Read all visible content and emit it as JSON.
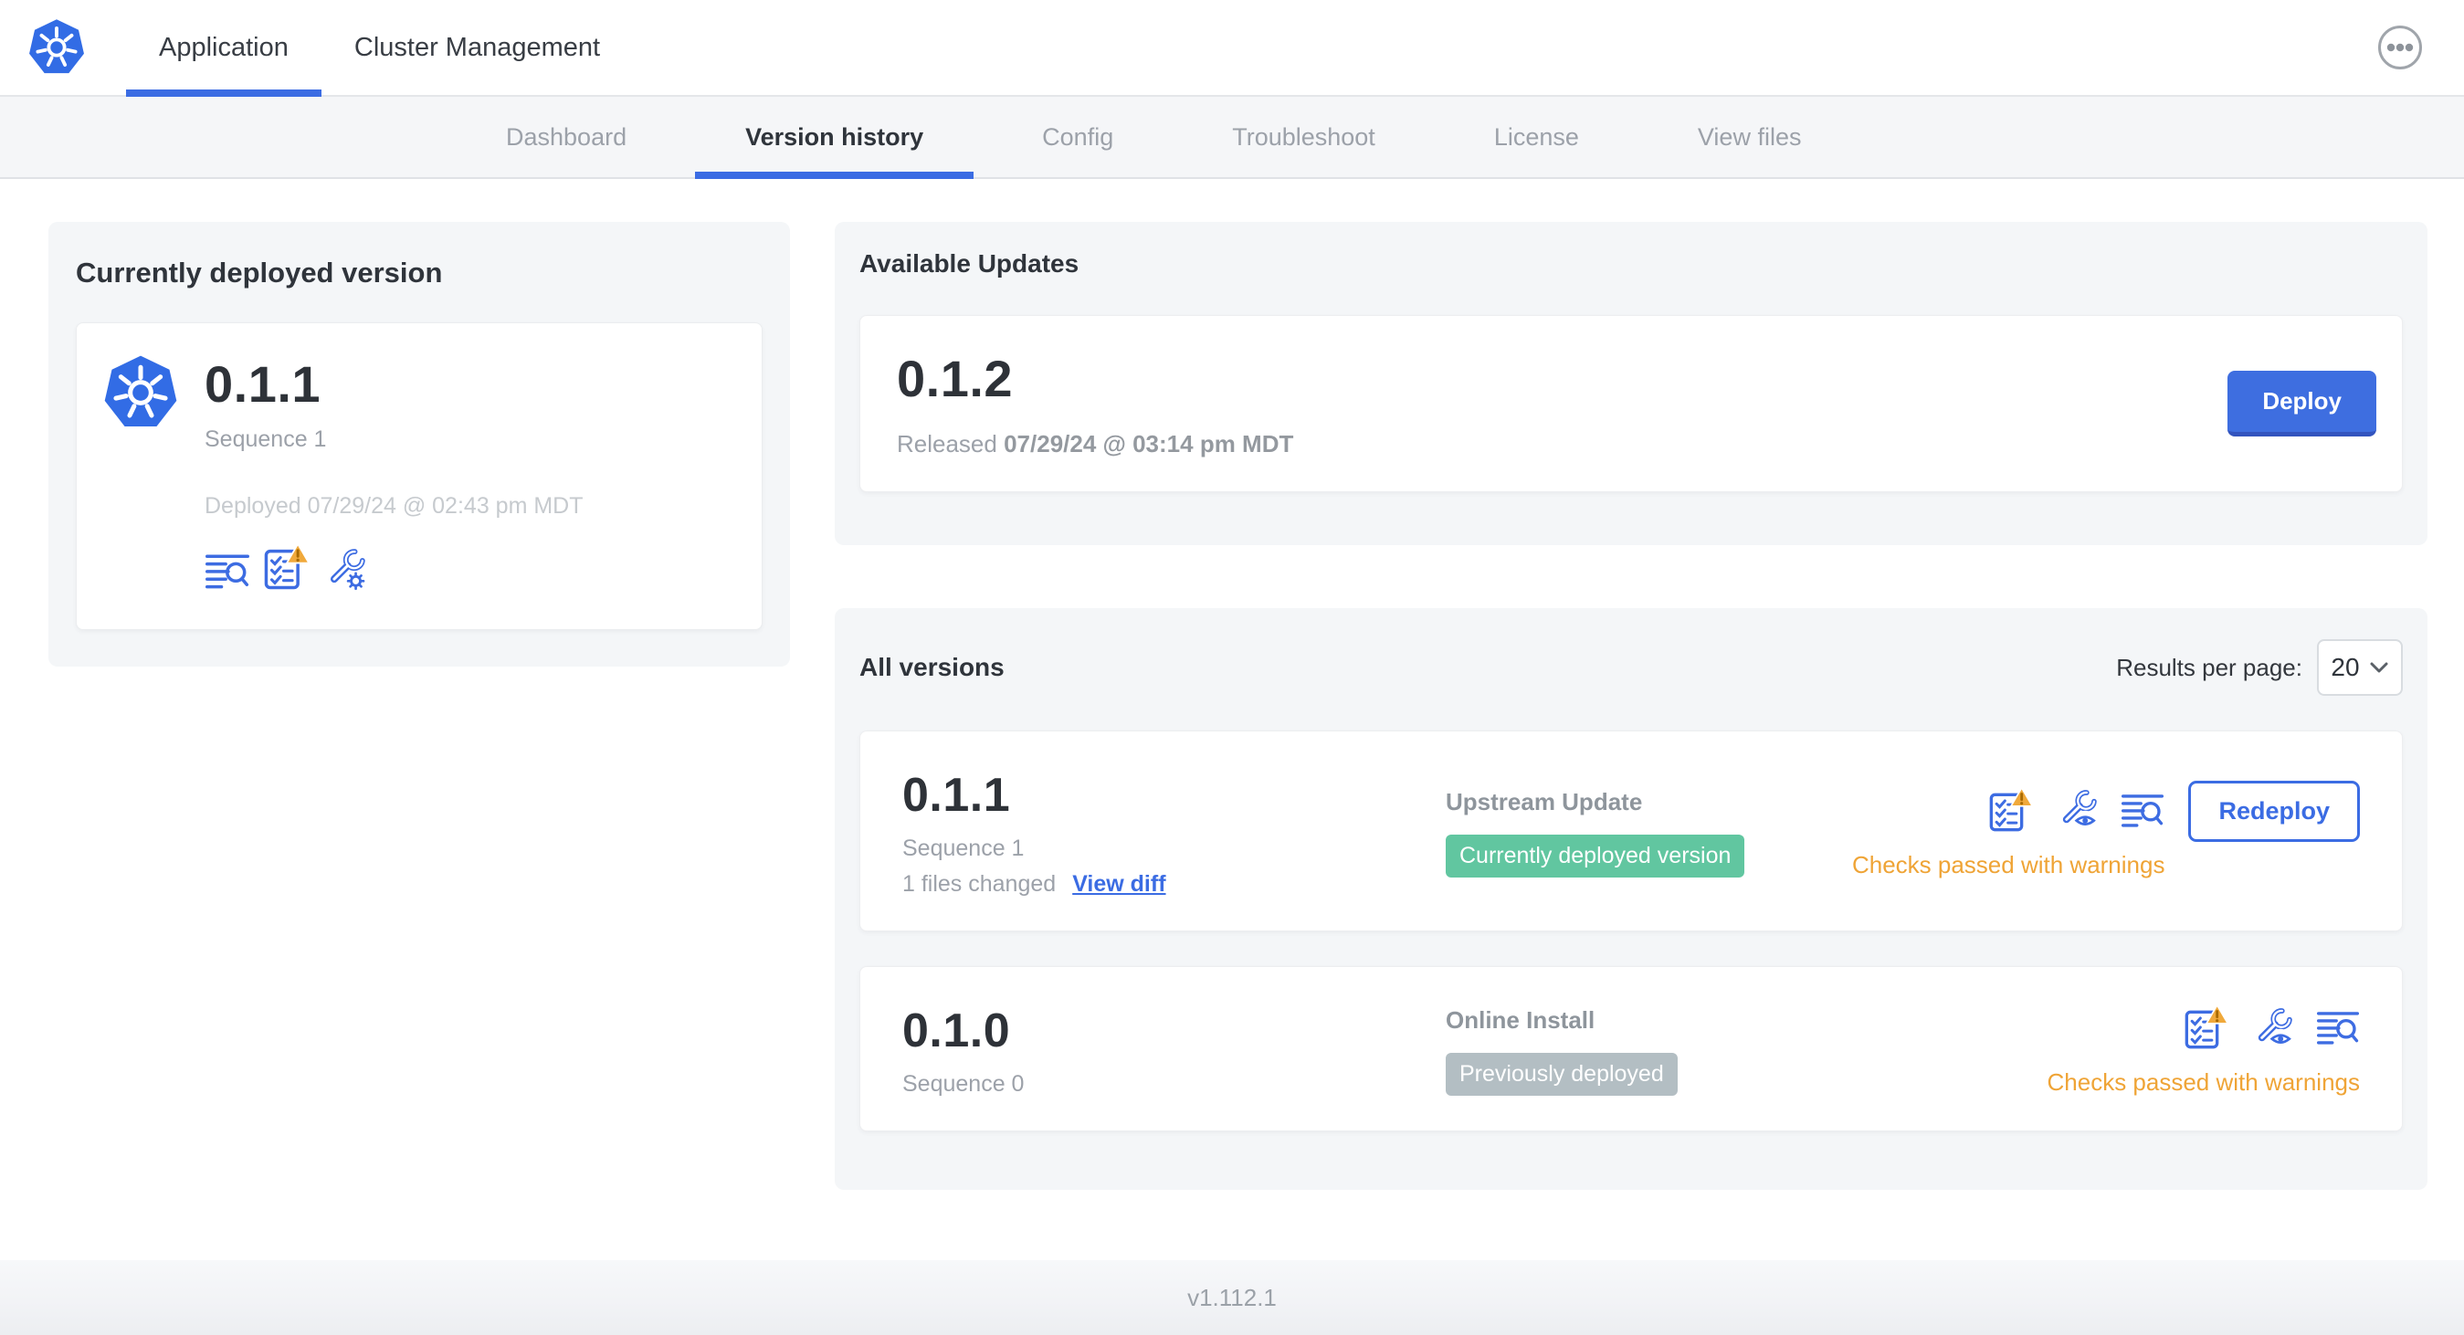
{
  "topbar": {
    "tabs": [
      {
        "label": "Application"
      },
      {
        "label": "Cluster Management"
      }
    ]
  },
  "subnav": {
    "tabs": [
      {
        "label": "Dashboard"
      },
      {
        "label": "Version history"
      },
      {
        "label": "Config"
      },
      {
        "label": "Troubleshoot"
      },
      {
        "label": "License"
      },
      {
        "label": "View files"
      }
    ],
    "active_tab": "Version history"
  },
  "current": {
    "title": "Currently deployed version",
    "version": "0.1.1",
    "sequence": "Sequence 1",
    "deployed": "Deployed 07/29/24 @ 02:43 pm MDT"
  },
  "updates": {
    "title": "Available Updates",
    "version": "0.1.2",
    "released_label": "Released",
    "released_date": "07/29/24 @ 03:14 pm MDT",
    "deploy_label": "Deploy"
  },
  "all_versions": {
    "title": "All versions",
    "results_label": "Results per page:",
    "results_value": "20",
    "rows": [
      {
        "version": "0.1.1",
        "sequence": "Sequence 1",
        "files_changed": "1 files changed",
        "view_diff_label": "View diff",
        "source": "Upstream Update",
        "badge_label": "Currently deployed version",
        "badge_type": "green",
        "checks_label": "Checks passed with warnings",
        "action_label": "Redeploy"
      },
      {
        "version": "0.1.0",
        "sequence": "Sequence 0",
        "source": "Online Install",
        "badge_label": "Previously deployed",
        "badge_type": "gray",
        "checks_label": "Checks passed with warnings"
      }
    ]
  },
  "footer": {
    "app_version": "v1.112.1"
  },
  "icons": {
    "logo": "kubernetes-logo",
    "menu": "ellipsis-menu",
    "logs": "logs-search",
    "preflight": "checklist-with-warning",
    "config_edit": "wrench-gear",
    "config_view": "wrench-eye",
    "select": "chevron-down"
  },
  "colors": {
    "k8s_blue": "#326CE5",
    "accent_blue": "#3D6CE2",
    "button_blue": "#3E6EE0",
    "green_badge": "#61C6A0",
    "gray_badge": "#B3BEC3",
    "warning_orange": "#EFA436",
    "subnav_bg": "#F5F6F8",
    "card_bg": "#F4F6F8"
  }
}
